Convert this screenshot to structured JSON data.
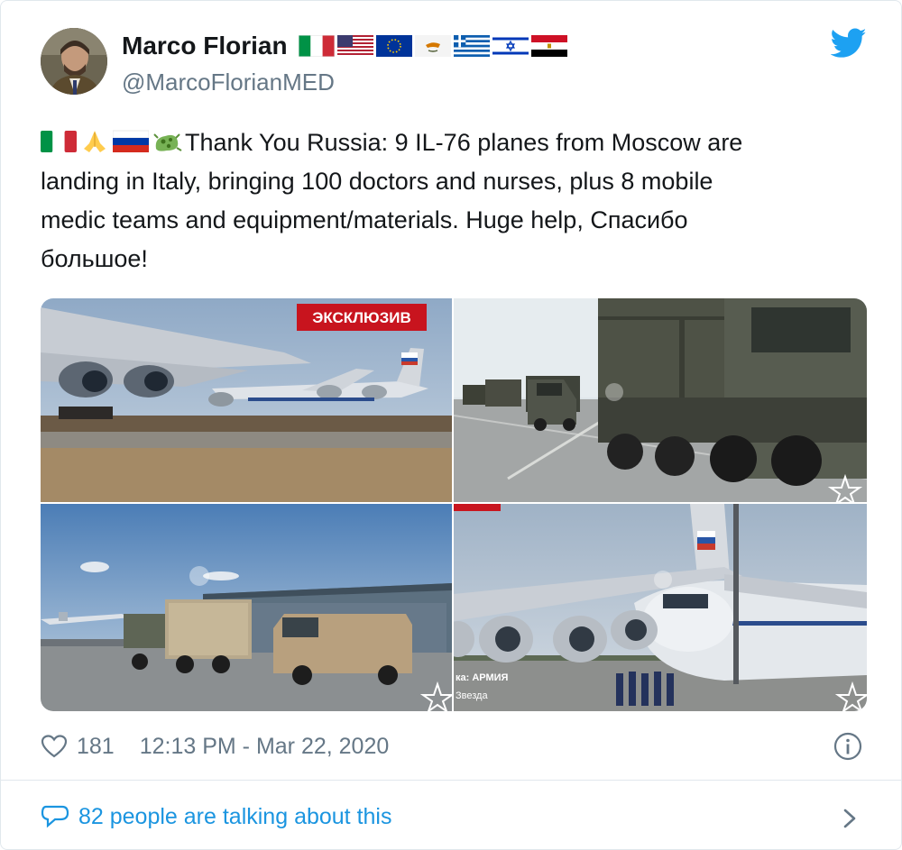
{
  "author": {
    "name": "Marco Florian",
    "handle": "@MarcoFlorianMED",
    "flags": [
      "italy-flag-icon",
      "usa-flag-icon",
      "eu-flag-icon",
      "cyprus-flag-icon",
      "greece-flag-icon",
      "israel-flag-icon",
      "egypt-flag-icon"
    ]
  },
  "tweet": {
    "emojis": [
      "italy-flag-icon",
      "folded-hands-icon",
      "russia-flag-icon",
      "microbe-icon"
    ],
    "text_line1": "Thank You Russia: 9 IL-76 planes from Moscow are",
    "text_line2": "landing in Italy, bringing 100 doctors and nurses, plus 8 mobile",
    "text_line3": "medic teams and equipment/materials. Huge help, Спасибо",
    "text_line4": "большое!"
  },
  "media": {
    "photo1_badge": "ЭКСКЛЮЗИВ",
    "photo4_caption1": "ка: АРМИЯ",
    "photo4_caption2": "Звезда"
  },
  "footer": {
    "likes": "181",
    "timestamp": "12:13 PM - Mar 22, 2020",
    "talking": "82 people are talking about this"
  },
  "colors": {
    "link": "#1b95e0",
    "twitter_blue": "#1da1f2",
    "secondary_text": "#657786",
    "border": "#e1e8ed"
  }
}
